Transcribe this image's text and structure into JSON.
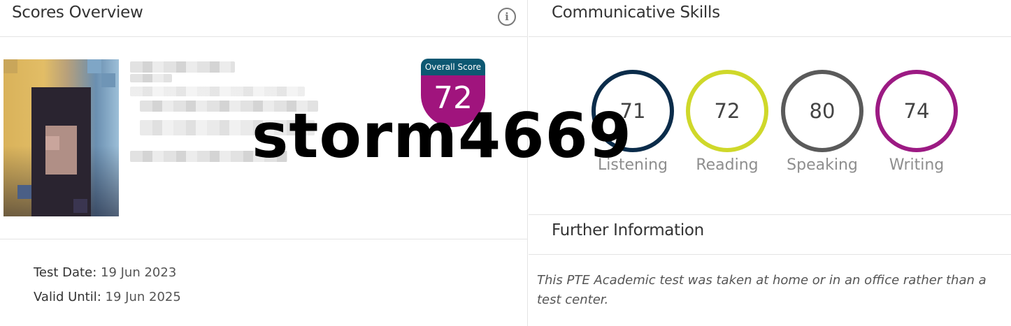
{
  "scores_overview": {
    "title": "Scores Overview",
    "info_icon": "info-icon",
    "overall_score": {
      "label": "Overall Score",
      "value": "72",
      "header_color": "#0d5872",
      "body_color": "#a0147d"
    },
    "test_date": {
      "label": "Test Date",
      "value": "19 Jun 2023"
    },
    "valid_until": {
      "label": "Valid Until",
      "value": "19 Jun 2025"
    }
  },
  "communicative_skills": {
    "title": "Communicative Skills",
    "skills": [
      {
        "label": "Listening",
        "value": "71",
        "color": "#0b2c4a"
      },
      {
        "label": "Reading",
        "value": "72",
        "color": "#cfd82a"
      },
      {
        "label": "Speaking",
        "value": "80",
        "color": "#5a5a5a"
      },
      {
        "label": "Writing",
        "value": "74",
        "color": "#9c1a83"
      }
    ]
  },
  "further_information": {
    "title": "Further Information",
    "text": "This PTE Academic test was taken at home or in an office rather than a test center."
  },
  "watermark": {
    "text": "storm4669"
  }
}
